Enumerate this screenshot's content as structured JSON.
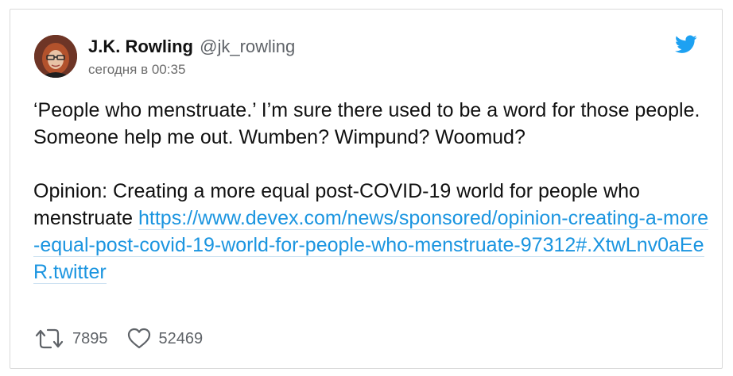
{
  "tweet": {
    "author": {
      "display_name": "J.K. Rowling",
      "handle": "@jk_rowling",
      "avatar_icon": "profile-photo"
    },
    "timestamp": "сегодня в 00:35",
    "text_1": "‘People who menstruate.’ I’m sure there used to be a word for those people. Someone help me out. Wumben? Wimpund? Woomud?",
    "text_2_prefix": "Opinion: Creating a more equal post-COVID-19 world for people who menstruate ",
    "link": "https://www.devex.com/news/sponsored/opinion-creating-a-more-equal-post-covid-19-world-for-people-who-menstruate-97312#.XtwLnv0aEeR.twitter",
    "retweets": "7895",
    "likes": "52469"
  },
  "icons": {
    "brand": "twitter-bird-icon",
    "retweet": "retweet-icon",
    "like": "heart-icon"
  },
  "colors": {
    "link": "#1b95e0",
    "twitter_blue": "#1da1f2",
    "muted_text": "#5f6368",
    "border": "#d9d9d9"
  }
}
